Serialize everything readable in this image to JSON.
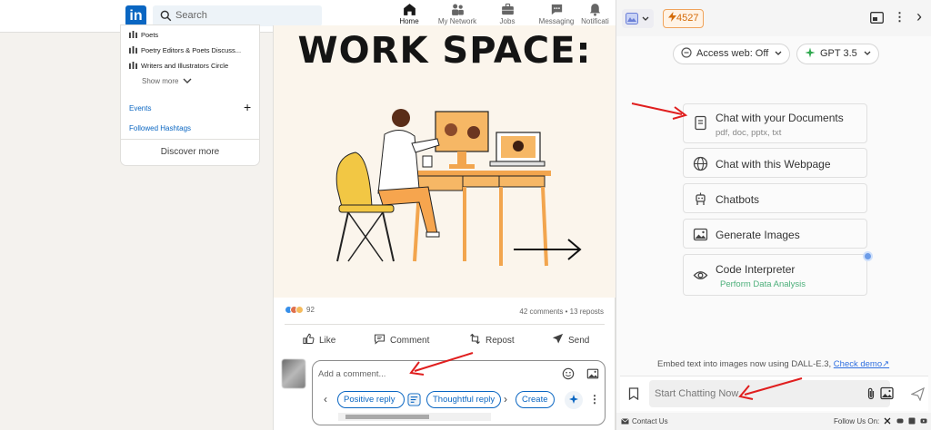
{
  "topbar": {
    "logo_text": "in",
    "search_placeholder": "Search",
    "nav": [
      {
        "label": "Home",
        "icon": "home-icon",
        "active": true
      },
      {
        "label": "My Network",
        "icon": "network-icon",
        "active": false
      },
      {
        "label": "Jobs",
        "icon": "briefcase-icon",
        "active": false
      },
      {
        "label": "Messaging",
        "icon": "chat-icon",
        "active": false
      },
      {
        "label": "Notificati",
        "icon": "bell-icon",
        "active": false
      }
    ]
  },
  "sidebar": {
    "groups": [
      "Poets",
      "Poetry Editors & Poets Discuss...",
      "Writers and Illustrators Circle"
    ],
    "show_more": "Show more",
    "events": "Events",
    "followed_hashtags": "Followed Hashtags",
    "discover_more": "Discover more"
  },
  "post": {
    "image_title": "WORK SPACE:",
    "reaction_count": "92",
    "stats": "42 comments • 13 reposts",
    "actions": {
      "like": "Like",
      "comment": "Comment",
      "repost": "Repost",
      "send": "Send"
    },
    "comment_placeholder": "Add a comment...",
    "suggestions": [
      "Positive reply",
      "Thoughtful reply"
    ],
    "create": "Create"
  },
  "panel": {
    "credits": "4527",
    "toggles": {
      "access_web": "Access web: Off",
      "model": "GPT 3.5"
    },
    "features": [
      {
        "title": "Chat with your Documents",
        "subtitle": "pdf, doc, pptx, txt",
        "icon": "document-icon"
      },
      {
        "title": "Chat with this Webpage",
        "subtitle": "",
        "icon": "globe-icon"
      },
      {
        "title": "Chatbots",
        "subtitle": "",
        "icon": "robot-icon"
      },
      {
        "title": "Generate Images",
        "subtitle": "",
        "icon": "image-icon"
      },
      {
        "title": "Code Interpreter",
        "subtitle": "Perform Data Analysis",
        "icon": "eye-icon"
      }
    ],
    "tip_text": "Embed text into images now using DALL-E.3,",
    "tip_link": "Check demo↗",
    "chat_placeholder": "Start Chatting Now",
    "footer": {
      "contact": "Contact Us",
      "follow": "Follow Us On:"
    }
  },
  "colors": {
    "linkedin_blue": "#0a66c2",
    "annotation_red": "#e01e1e",
    "credit_orange": "#d46b08",
    "model_green": "#2fa84f"
  }
}
